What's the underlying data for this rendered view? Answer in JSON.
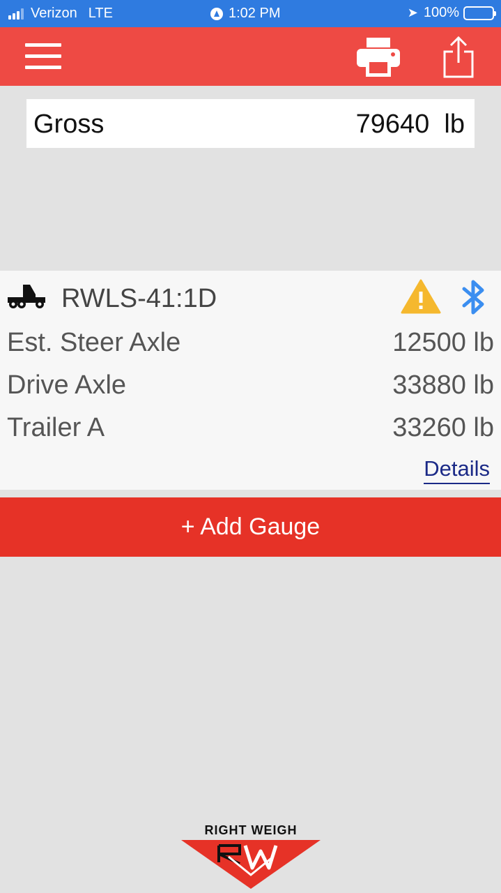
{
  "status_bar": {
    "carrier": "Verizon",
    "network": "LTE",
    "time": "1:02 PM",
    "battery": "100%"
  },
  "header": {
    "menu_icon": "hamburger-menu-icon",
    "print_icon": "printer-icon",
    "share_icon": "share-icon",
    "color": "#ee4a44"
  },
  "gross": {
    "label": "Gross",
    "value": "79640  lb"
  },
  "gauge": {
    "name": "RWLS-41:1D",
    "truck_icon": "truck-icon",
    "warning_icon": "warning-icon",
    "bluetooth_icon": "bluetooth-icon",
    "axles": [
      {
        "label": "Est. Steer Axle",
        "value": "12500 lb"
      },
      {
        "label": "Drive Axle",
        "value": "33880 lb"
      },
      {
        "label": "Trailer A",
        "value": "33260 lb"
      }
    ],
    "details_label": "Details"
  },
  "add_gauge_label": "+ Add Gauge",
  "logo": {
    "text": "RIGHT WEIGH",
    "mark": "RW"
  },
  "colors": {
    "status_bar": "#2f7be0",
    "accent_red": "#e63227",
    "warning": "#f5b82e",
    "bluetooth": "#3b8ef0",
    "link": "#1b2a87"
  }
}
